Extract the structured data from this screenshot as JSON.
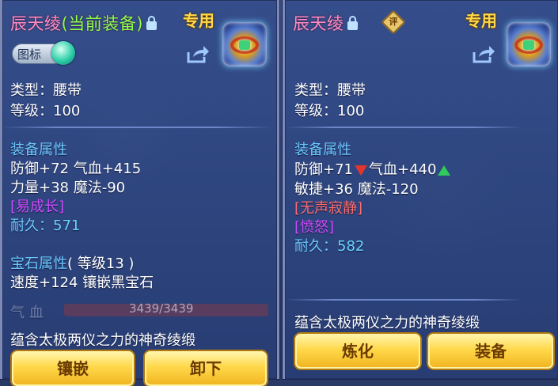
{
  "left": {
    "title_name": "辰天绫",
    "title_equipped": "(当前装备)",
    "special": "专用",
    "badge_label": "图标",
    "type": "类型：腰带",
    "level": "等级：100",
    "attr_header": "装备属性",
    "attr_line1": "防御+72 气血+415",
    "attr_line2": "力量+38 魔法-90",
    "trait": "[易成长]",
    "durability_label": "耐久：",
    "durability_value": "571",
    "gem_header": "宝石属性",
    "gem_level": "( 等级13 )",
    "gem_line": "速度+124 镶嵌黑宝石",
    "hp_label": "气 血",
    "hp_value": "3439/3439",
    "description": "蕴含太极两仪之力的神奇绫缎",
    "btn_inlay": "镶嵌",
    "btn_remove": "卸下"
  },
  "right": {
    "title_name": "辰天绫",
    "rate_icon": "评",
    "special": "专用",
    "type": "类型：腰带",
    "level": "等级：100",
    "attr_header": "装备属性",
    "attr_def": "防御+71",
    "attr_hp": "气血+440",
    "attr_line2": "敏捷+36 魔法-120",
    "trait1": "[无声寂静]",
    "trait2": "[愤怒]",
    "durability_label": "耐久：",
    "durability_value": "582",
    "description": "蕴含太极两仪之力的神奇绫缎",
    "btn_refine": "炼化",
    "btn_equip": "装备"
  },
  "colors": {
    "title": "#ff8dc4",
    "equipped": "#8cff4a",
    "section": "#6cc8ff",
    "trait_purple": "#d24bff",
    "trait_red": "#ff6f6f",
    "button": "#ffd84a"
  }
}
